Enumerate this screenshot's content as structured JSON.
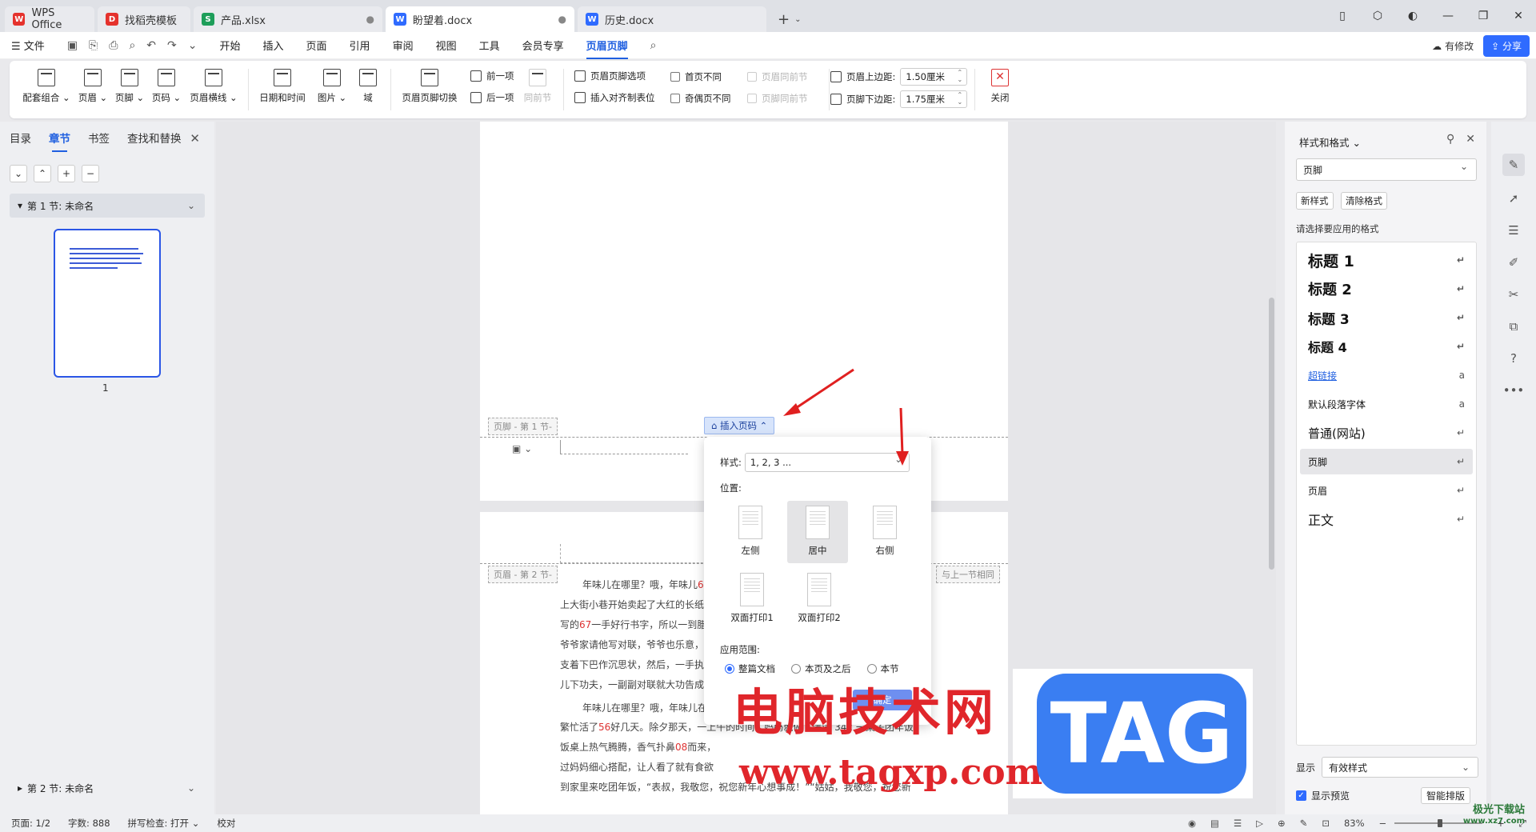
{
  "tabs": [
    {
      "label": "WPS Office",
      "icon": "wps-logo-icon",
      "color": "#e5322d"
    },
    {
      "label": "找稻壳模板",
      "icon": "docer-icon",
      "color": "#e5322d"
    },
    {
      "label": "产品.xlsx",
      "icon": "spreadsheet-icon",
      "color": "#1e9e5a"
    },
    {
      "label": "盼望着.docx",
      "icon": "writer-icon",
      "color": "#2f6bff"
    },
    {
      "label": "历史.docx",
      "icon": "writer-icon",
      "color": "#2f6bff"
    }
  ],
  "menubar": {
    "file": "文件",
    "items": [
      "开始",
      "插入",
      "页面",
      "引用",
      "审阅",
      "视图",
      "工具",
      "会员专享",
      "页眉页脚"
    ],
    "active": "页眉页脚",
    "modified": "有修改",
    "share": "分享"
  },
  "ribbon": {
    "combo": "配套组合",
    "header": "页眉",
    "footer": "页脚",
    "page_number": "页码",
    "header_line": "页眉横线",
    "datetime": "日期和时间",
    "picture": "图片",
    "field": "域",
    "switch": "页眉页脚切换",
    "prev": "前一项",
    "next": "后一项",
    "same_prev": "同前节",
    "hf_options": "页眉页脚选项",
    "insert_tab": "插入对齐制表位",
    "first_diff": "首页不同",
    "odd_even_diff": "奇偶页不同",
    "header_same_prev": "页眉同前节",
    "footer_same_prev": "页脚同前节",
    "header_top": "页眉上边距:",
    "header_top_val": "1.50厘米",
    "footer_bottom": "页脚下边距:",
    "footer_bottom_val": "1.75厘米",
    "close": "关闭"
  },
  "left_panel": {
    "tabs": [
      "目录",
      "章节",
      "书签",
      "查找和替换"
    ],
    "active": "章节",
    "section1": "第 1 节: 未命名",
    "section2": "第 2 节: 未命名",
    "page_label": "1"
  },
  "document": {
    "footer_tag": "页脚 - 第 1 节-",
    "insert_page_number": "插入页码",
    "header_tag_2": "页眉 - 第 2 节-",
    "same_as_prev": "与上一节相同",
    "lines": [
      {
        "pre": "年味儿在哪里？哦，年味儿",
        "red": "6",
        "post": ""
      },
      {
        "pre": "上大街小巷开始卖起了大红的长纸",
        "red": "",
        "post": ""
      },
      {
        "pre": "写的",
        "red": "67",
        "post": "一手好行书字，所以一到腊"
      },
      {
        "pre": "爷爷家请他写对联，爷爷也乐意，",
        "red": "",
        "post": ""
      },
      {
        "pre": "支着下巴作沉思状，然后，一手执",
        "red": "",
        "post": ""
      },
      {
        "pre": "儿下功夫，一副副对联就大功告成",
        "red": "",
        "post": ""
      },
      {
        "pre": "年味儿在哪里？哦，年味儿在",
        "red": "",
        "post": ""
      },
      {
        "pre": "繁忙活了",
        "red": "56",
        "post": "好几天。除夕那天，一上午的时间，妈妈就做了满满 342 一桌子团年饭"
      },
      {
        "pre": "饭桌上热气腾腾，香气扑鼻",
        "red": "08",
        "post": "而来，"
      },
      {
        "pre": "过妈妈细心搭配，让人看了就有食欲",
        "red": "",
        "post": ""
      },
      {
        "pre": "到家里来吃团年饭，“表叔，我敬您，祝您新年心想事成！”“姑姑，我敬您，祝您新",
        "red": "",
        "post": ""
      }
    ]
  },
  "popup": {
    "style_label": "样式:",
    "style_value": "1, 2, 3 ...",
    "position_label": "位置:",
    "positions": [
      "左侧",
      "居中",
      "右侧",
      "双面打印1",
      "双面打印2"
    ],
    "selected_position": "居中",
    "scope_label": "应用范围:",
    "scopes": [
      "整篇文档",
      "本页及之后",
      "本节"
    ],
    "selected_scope": "整篇文档",
    "confirm": "确定"
  },
  "watermark": {
    "cn": "电脑技术网",
    "tag": "TAG",
    "url": "www.tagxp.com"
  },
  "right_panel": {
    "title": "样式和格式",
    "current": "页脚",
    "new_style": "新样式",
    "clear_format": "清除格式",
    "hint": "请选择要应用的格式",
    "styles": [
      "标题 1",
      "标题 2",
      "标题 3",
      "标题 4",
      "超链接",
      "默认段落字体",
      "普通(网站)",
      "页脚",
      "页眉",
      "正文"
    ],
    "selected": "页脚",
    "show_label": "显示",
    "show_value": "有效样式",
    "preview": "显示预览",
    "smart": "智能排版"
  },
  "statusbar": {
    "page": "页面: 1/2",
    "words": "字数: 888",
    "spell": "拼写检查: 打开",
    "proof": "校对",
    "zoom": "83%"
  },
  "brand_site": "极光下载站",
  "brand_url": "www.xz7.com"
}
